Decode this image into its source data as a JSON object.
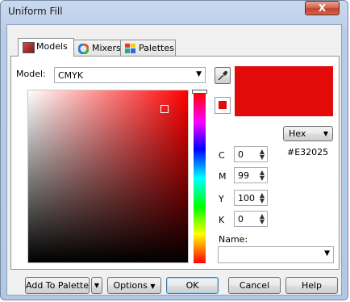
{
  "window": {
    "title": "Uniform Fill",
    "close_glyph": "X"
  },
  "tabs": [
    {
      "label": "Models",
      "icon": "models-icon",
      "active": true
    },
    {
      "label": "Mixers",
      "icon": "mixers-icon",
      "active": false
    },
    {
      "label": "Palettes",
      "icon": "palettes-icon",
      "active": false
    }
  ],
  "model": {
    "label": "Model:",
    "value": "CMYK"
  },
  "current_color": "#E32025",
  "format": {
    "value": "Hex",
    "hex_value": "#E32025"
  },
  "components": [
    {
      "label": "C",
      "value": "0"
    },
    {
      "label": "M",
      "value": "99"
    },
    {
      "label": "Y",
      "value": "100"
    },
    {
      "label": "K",
      "value": "0"
    }
  ],
  "name": {
    "label": "Name:",
    "value": ""
  },
  "buttons": {
    "add_to_palette": "Add To Palette",
    "options": "Options",
    "ok": "OK",
    "cancel": "Cancel",
    "help": "Help"
  }
}
